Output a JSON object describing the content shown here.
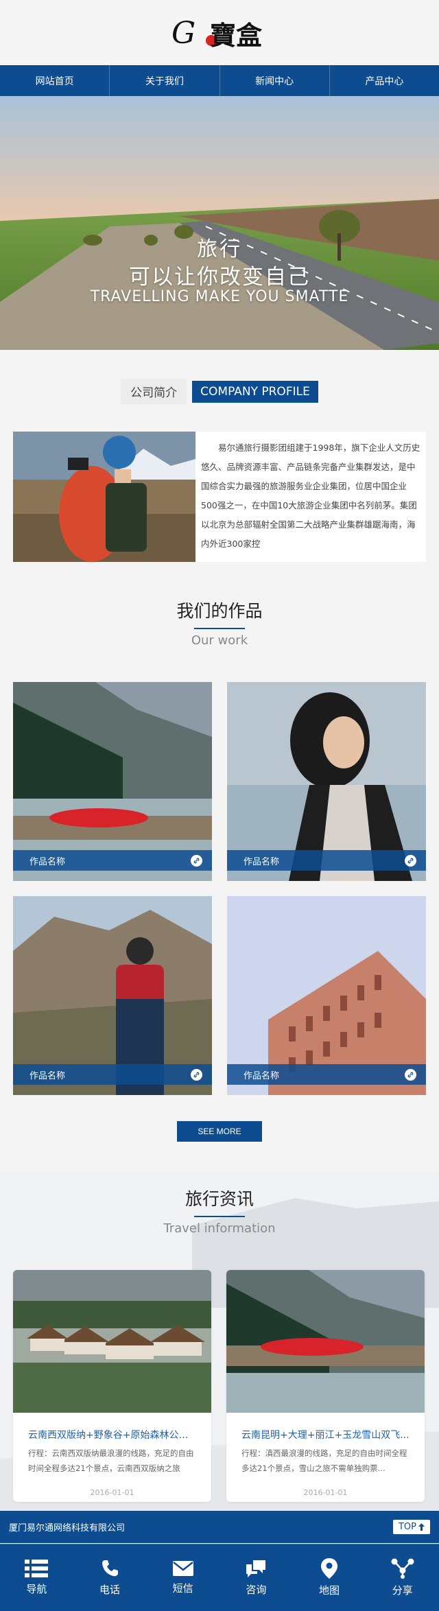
{
  "header": {
    "logo_text": "G寶盒"
  },
  "nav": [
    {
      "label": "网站首页"
    },
    {
      "label": "关于我们"
    },
    {
      "label": "新闻中心"
    },
    {
      "label": "产品中心"
    }
  ],
  "banner": {
    "line1": "旅行",
    "line2": "可以让你改变自己",
    "line3": "TRAVELLING MAKE YOU SMATTE"
  },
  "profile": {
    "title_cn": "公司简介",
    "title_en": "COMPANY PROFILE",
    "text": "易尔通旅行摄影团组建于1998年，旗下企业人文历史悠久、品牌资源丰富、产品链条完备产业集群发达，是中国综合实力最强的旅游服务业企业集团，位居中国企业500强之一，在中国10大旅游企业集团中名列前茅。集团以北京为总部辐射全国第二大战略产业集群雄踞海南，海内外近300家控"
  },
  "works": {
    "title": "我们的作品",
    "subtitle": "Our work",
    "items": [
      {
        "caption": "作品名称"
      },
      {
        "caption": "作品名称"
      },
      {
        "caption": "作品名称"
      },
      {
        "caption": "作品名称"
      }
    ],
    "more_label": "SEE MORE"
  },
  "travel": {
    "title": "旅行资讯",
    "subtitle": "Travel information",
    "items": [
      {
        "title": "云南西双版纳+野象谷+原始森林公园...",
        "desc": "行程：云南西双版纳最浪漫的线路，充足的自由时间全程多达21个景点，云南西双版纳之旅",
        "date": "2016-01-01"
      },
      {
        "title": "云南昆明+大理+丽江+玉龙雪山双飞...",
        "desc": "行程：滇西最浪漫的线路，充足的自由时间全程多达21个景点，雪山之旅不需单独购票...",
        "date": "2016-01-01"
      }
    ]
  },
  "footer": {
    "company": "厦门易尔通网络科技有限公司",
    "top_label": "TOP"
  },
  "bottom_nav": [
    {
      "label": "导航",
      "icon": "menu-icon"
    },
    {
      "label": "电话",
      "icon": "phone-icon"
    },
    {
      "label": "短信",
      "icon": "mail-icon"
    },
    {
      "label": "咨询",
      "icon": "chat-icon"
    },
    {
      "label": "地图",
      "icon": "map-pin-icon"
    },
    {
      "label": "分享",
      "icon": "share-icon"
    }
  ],
  "colors": {
    "brand": "#0e4c92",
    "link": "#1d62b1"
  }
}
